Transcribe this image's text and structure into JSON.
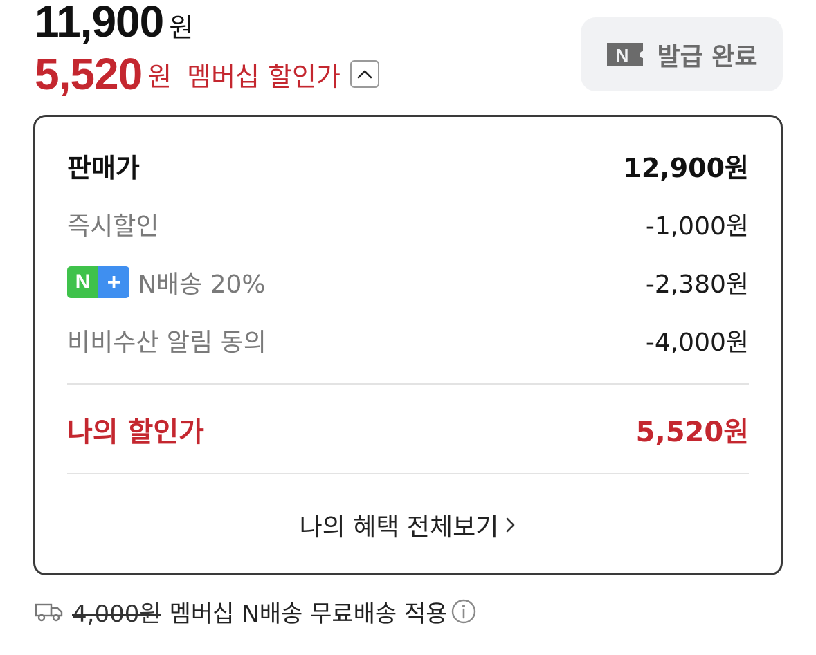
{
  "price": {
    "original_value": "11,900",
    "original_unit": "원",
    "member_value": "5,520",
    "member_unit": "원",
    "member_label": "멤버십 할인가"
  },
  "coupon": {
    "badge_icon": "naver-n-icon",
    "label": "발급 완료"
  },
  "breakdown": {
    "base": {
      "label": "판매가",
      "value": "12,900원"
    },
    "discounts": [
      {
        "label": "즉시할인",
        "value": "-1,000원"
      },
      {
        "label": "N배송 20%",
        "value": "-2,380원",
        "badge": {
          "n": "N",
          "plus": "+"
        }
      },
      {
        "label": "비비수산 알림 동의",
        "value": "-4,000원"
      }
    ],
    "total": {
      "label": "나의 할인가",
      "value": "5,520원"
    },
    "view_all": "나의 혜택 전체보기"
  },
  "shipping": {
    "icon": "truck-icon",
    "original_fee": "4,000원",
    "text": "멤버십 N배송 무료배송 적용",
    "info_icon": "info-icon"
  },
  "colors": {
    "accent_red": "#c4272f",
    "naver_green": "#3fc24b",
    "plus_blue": "#3f8ff0"
  }
}
